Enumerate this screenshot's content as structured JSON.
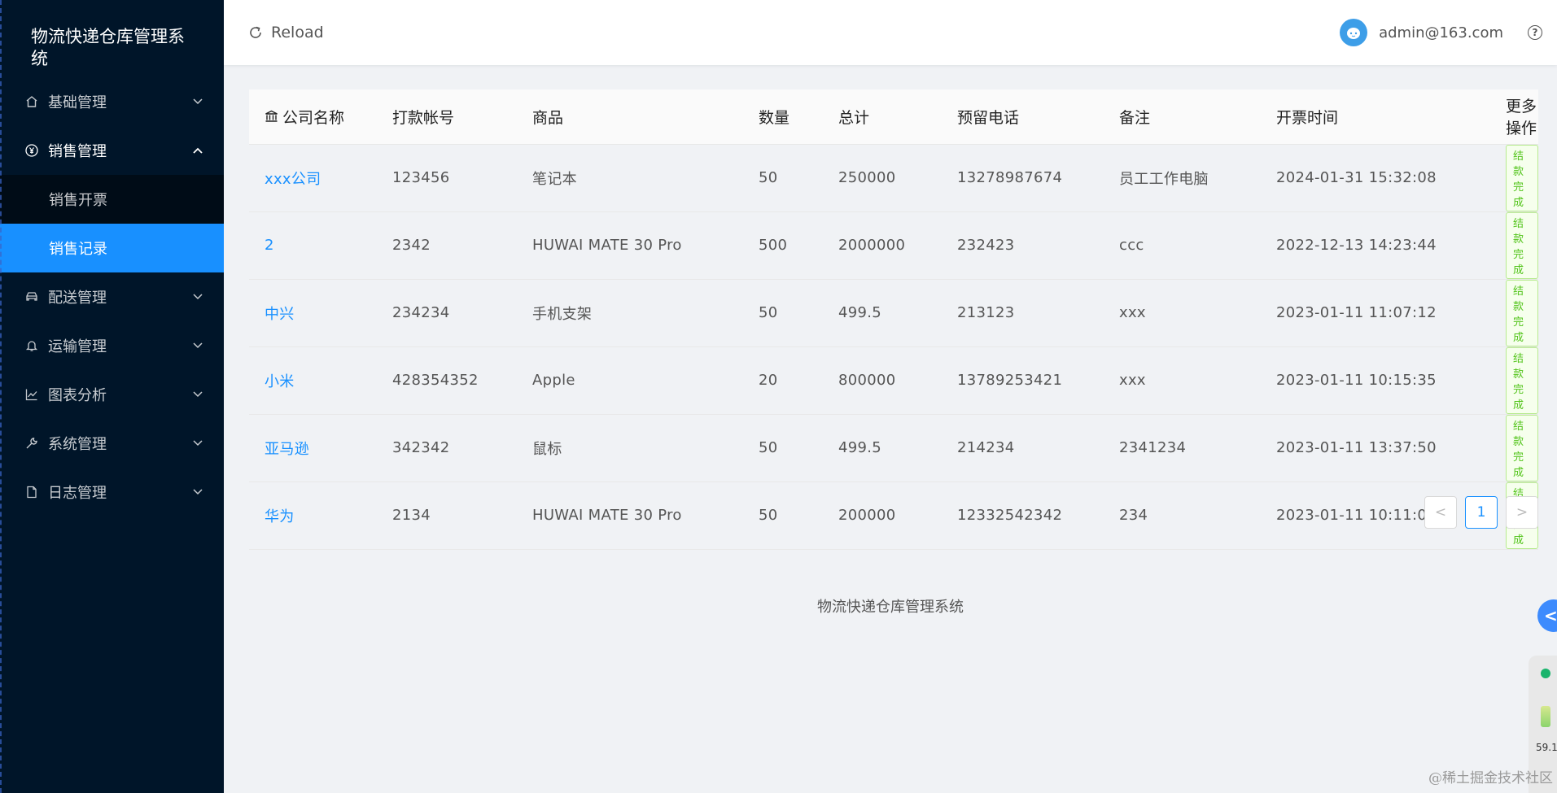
{
  "app": {
    "title": "物流快递仓库管理系统"
  },
  "sidebar": {
    "items": [
      {
        "label": "基础管理",
        "icon": "home-icon"
      },
      {
        "label": "销售管理",
        "icon": "yen-icon",
        "open": true
      },
      {
        "label": "配送管理",
        "icon": "car-icon"
      },
      {
        "label": "运输管理",
        "icon": "bell-icon"
      },
      {
        "label": "图表分析",
        "icon": "line-chart-icon"
      },
      {
        "label": "系统管理",
        "icon": "wrench-icon"
      },
      {
        "label": "日志管理",
        "icon": "file-icon"
      }
    ],
    "sales_sub": [
      {
        "label": "销售开票",
        "active": false
      },
      {
        "label": "销售记录",
        "active": true
      }
    ]
  },
  "header": {
    "reload": "Reload",
    "user": "admin@163.com",
    "help": "?"
  },
  "table": {
    "headers": [
      "公司名称",
      "打款帐号",
      "商品",
      "数量",
      "总计",
      "预留电话",
      "备注",
      "开票时间",
      "更多操作"
    ],
    "rows": [
      [
        "xxx公司",
        "123456",
        "笔记本",
        "50",
        "250000",
        "13278987674",
        "员工工作电脑",
        "2024-01-31 15:32:08",
        "结款完成"
      ],
      [
        "2",
        "2342",
        "HUWAI MATE 30 Pro",
        "500",
        "2000000",
        "232423",
        "ccc",
        "2022-12-13 14:23:44",
        "结款完成"
      ],
      [
        "中兴",
        "234234",
        "手机支架",
        "50",
        "499.5",
        "213123",
        "xxx",
        "2023-01-11 11:07:12",
        "结款完成"
      ],
      [
        "小米",
        "428354352",
        "Apple",
        "20",
        "800000",
        "13789253421",
        "xxx",
        "2023-01-11 10:15:35",
        "结款完成"
      ],
      [
        "亚马逊",
        "342342",
        "鼠标",
        "50",
        "499.5",
        "214234",
        "2341234",
        "2023-01-11 13:37:50",
        "结款完成"
      ],
      [
        "华为",
        "2134",
        "HUWAI MATE 30 Pro",
        "50",
        "200000",
        "12332542342",
        "234",
        "2023-01-11 10:11:07",
        "结款完成"
      ]
    ]
  },
  "pagination": {
    "prev": "<",
    "current": "1",
    "next": ">"
  },
  "footer": {
    "text": "物流快递仓库管理系统"
  },
  "widgets": {
    "float_arrow": "<",
    "monitor_value": "59.1"
  },
  "watermark": "@稀土掘金技术社区",
  "colors": {
    "sidebar_bg": "#001529",
    "accent": "#1890ff",
    "tag_green": "#52c41a"
  }
}
